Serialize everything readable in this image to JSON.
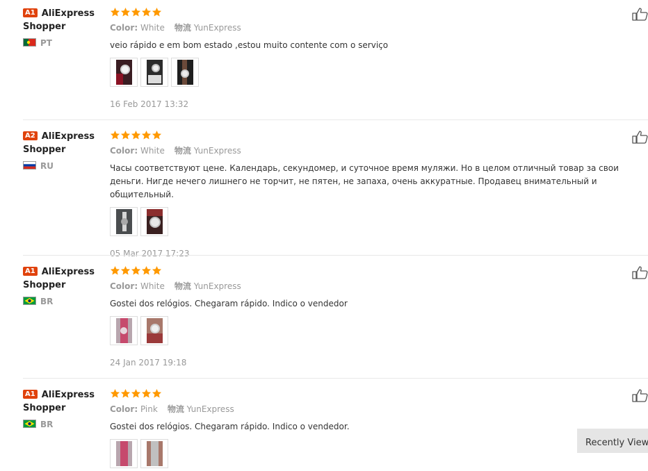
{
  "reviews": [
    {
      "level": "A1",
      "username": "AliExpress Shopper",
      "country": "PT",
      "color_label": "Color:",
      "color_value": "White",
      "logistics_label": "物流",
      "logistics_value": "YunExpress",
      "text": "veio rápido e em bom estado ,estou muito contente com o serviço",
      "date": "16 Feb 2017 13:32",
      "stars": 5,
      "photo_count": 3
    },
    {
      "level": "A2",
      "username": "AliExpress Shopper",
      "country": "RU",
      "color_label": "Color:",
      "color_value": "White",
      "logistics_label": "物流",
      "logistics_value": "YunExpress",
      "text": "Часы соответствуют цене. Календарь, секундомер, и суточное время муляжи. Но в целом отличный товар за свои деньги. Нигде нечего лишнего не торчит, не пятен, не запаха, очень аккуратные. Продавец внимательный и общительный.",
      "date": "05 Mar 2017 17:23",
      "stars": 5,
      "photo_count": 2
    },
    {
      "level": "A1",
      "username": "AliExpress Shopper",
      "country": "BR",
      "color_label": "Color:",
      "color_value": "White",
      "logistics_label": "物流",
      "logistics_value": "YunExpress",
      "text": "Gostei dos relógios. Chegaram rápido. Indico o vendedor",
      "date": "24 Jan 2017 19:18",
      "stars": 5,
      "photo_count": 2
    },
    {
      "level": "A1",
      "username": "AliExpress Shopper",
      "country": "BR",
      "color_label": "Color:",
      "color_value": "Pink",
      "logistics_label": "物流",
      "logistics_value": "YunExpress",
      "text": "Gostei dos relógios. Chegaram rápido. Indico o vendedor.",
      "date": "",
      "stars": 5,
      "photo_count": 2
    }
  ],
  "recently_viewed_label": "Recently Viewed",
  "colors": {
    "level_badge": "#e0420c",
    "star": "#ff9900",
    "muted_text": "#999999",
    "separator": "#e8e8e8"
  },
  "icons": {
    "like": "thumbs-up-icon",
    "star": "star-icon"
  }
}
